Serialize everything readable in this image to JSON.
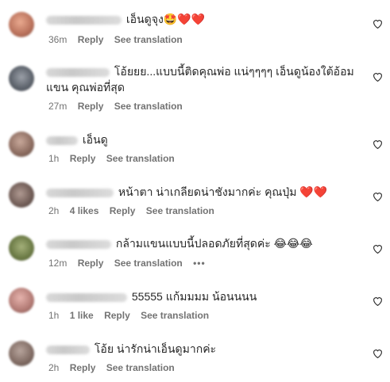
{
  "colors": {
    "text": "#262626",
    "meta": "#737373",
    "heart": "#e0245e"
  },
  "comments": [
    {
      "text": "เอ็นดูจุง🤩❤️❤️",
      "time": "36m",
      "likes": "",
      "reply": "Reply",
      "see_translation": "See translation"
    },
    {
      "text": "โอ้ยยย...แบบนี้ติดคุณพ่อ แน่ๆๆๆๆ เอ็นดูน้องใต้อ้อมแขน คุณพ่อที่สุด",
      "time": "27m",
      "likes": "",
      "reply": "Reply",
      "see_translation": "See translation"
    },
    {
      "text": "เอ็นดู",
      "time": "1h",
      "likes": "",
      "reply": "Reply",
      "see_translation": "See translation"
    },
    {
      "text": "หน้าตา น่าเกลียดน่าชังมากค่ะ คุณปุ่ม ❤️❤️",
      "time": "2h",
      "likes": "4 likes",
      "reply": "Reply",
      "see_translation": "See translation"
    },
    {
      "text": "กล้ามแขนแบบนี้ปลอดภัยที่สุดค่ะ 😂😂😂",
      "time": "12m",
      "likes": "",
      "reply": "Reply",
      "see_translation": "See translation",
      "more": "•••"
    },
    {
      "text": "55555 แก้มมมม น้อนนนน",
      "time": "1h",
      "likes": "1 like",
      "reply": "Reply",
      "see_translation": "See translation"
    },
    {
      "text": "โอ้ย น่ารักน่าเอ็นดูมากค่ะ",
      "time": "2h",
      "likes": "",
      "reply": "Reply",
      "see_translation": "See translation"
    }
  ]
}
